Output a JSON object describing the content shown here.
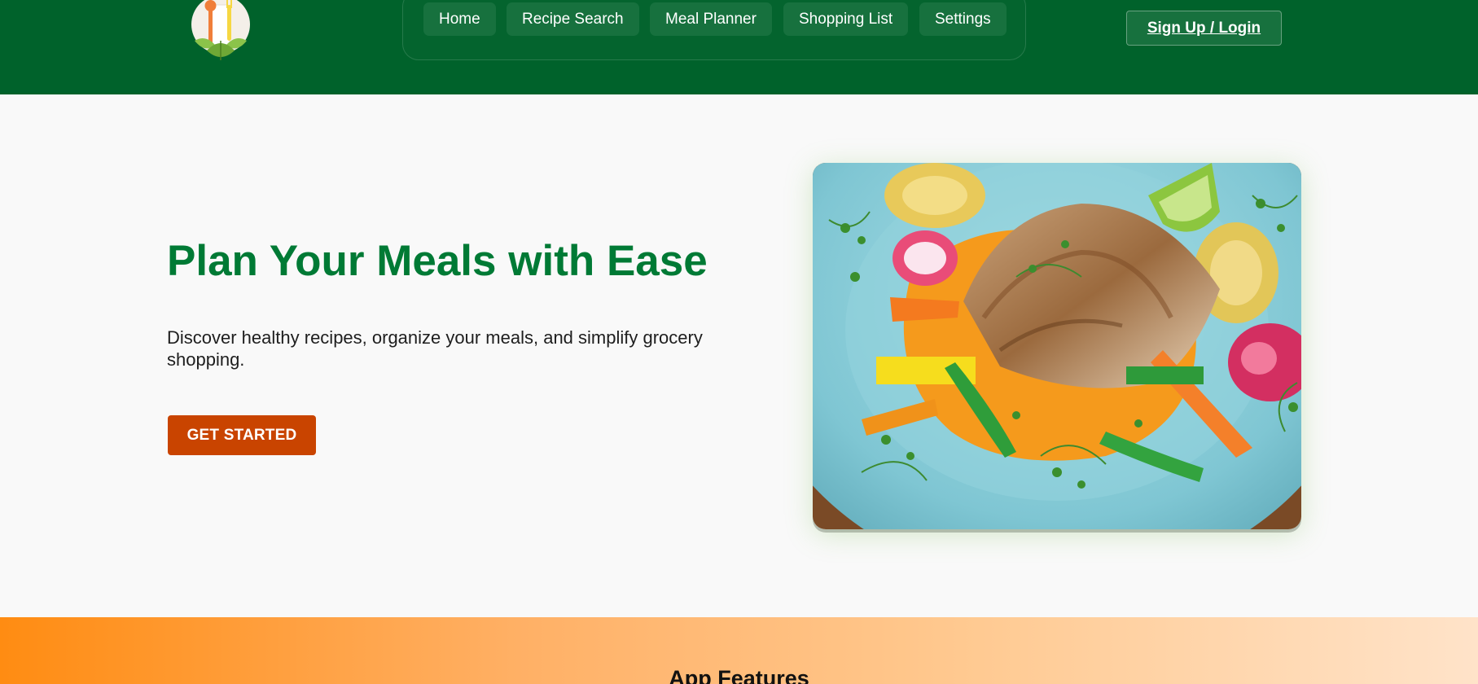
{
  "header": {
    "logo_icon": "cutlery-leaf-logo",
    "brand_color": "#00622b",
    "nav": [
      {
        "label": "Home"
      },
      {
        "label": "Recipe Search"
      },
      {
        "label": "Meal Planner"
      },
      {
        "label": "Shopping List"
      },
      {
        "label": "Settings"
      }
    ],
    "login_label": "Sign Up / Login"
  },
  "hero": {
    "title": "Plan Your Meals with Ease",
    "subtitle": "Discover healthy recipes, organize your meals, and simplify grocery shopping.",
    "cta_label": "GET STARTED",
    "title_color": "#007a35",
    "cta_color": "#c94400",
    "image": "plated-fish-with-vegetables"
  },
  "features": {
    "title": "App Features",
    "gradient_start": "#ff8c12",
    "gradient_end": "#ffe3c9"
  }
}
